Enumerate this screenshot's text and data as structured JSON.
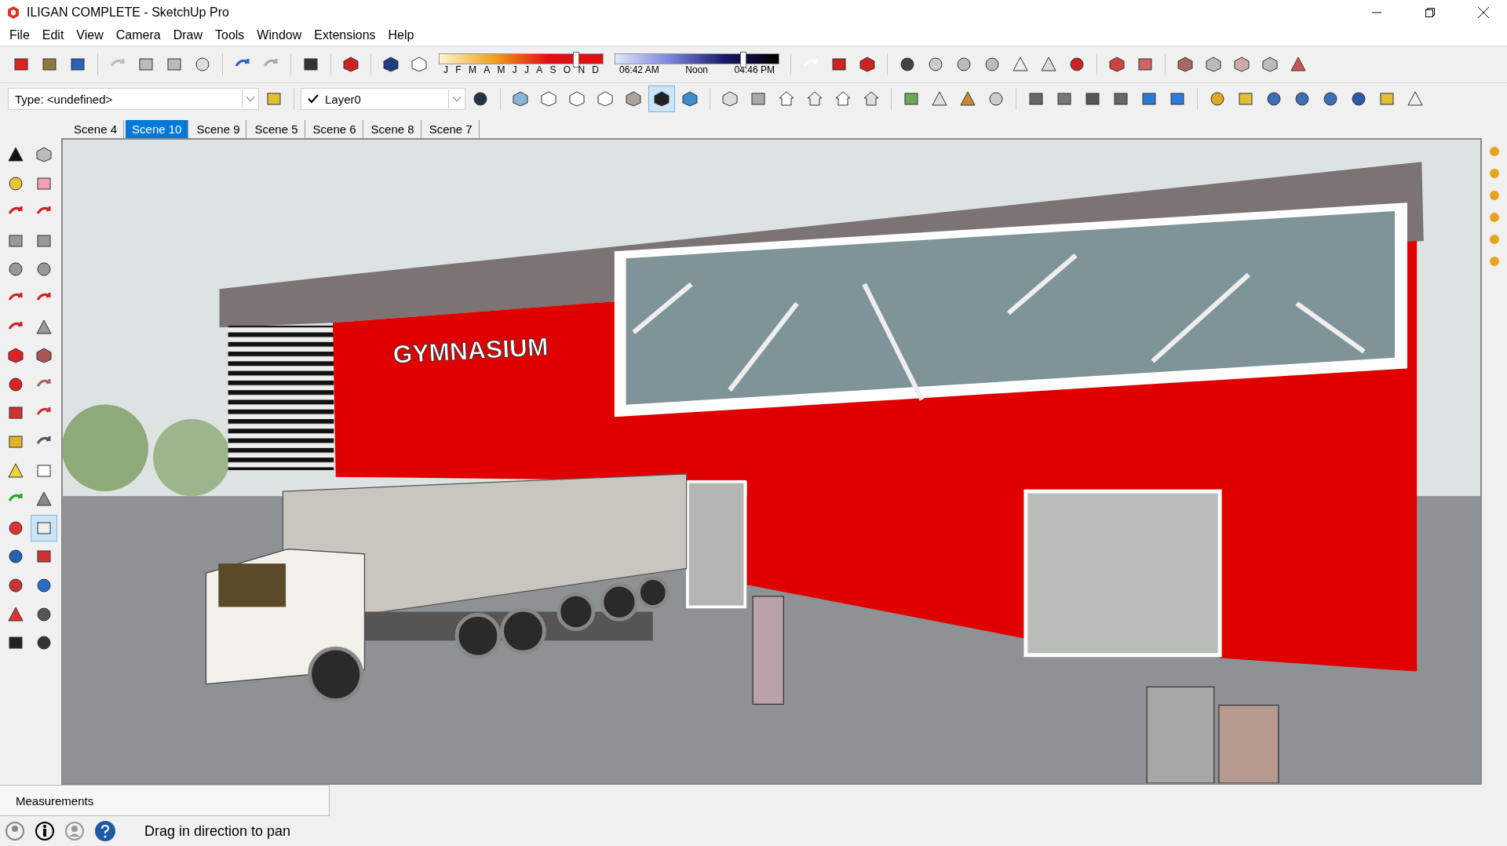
{
  "window": {
    "title": "ILIGAN COMPLETE - SketchUp Pro"
  },
  "menu": [
    "File",
    "Edit",
    "View",
    "Camera",
    "Draw",
    "Tools",
    "Window",
    "Extensions",
    "Help"
  ],
  "shadow_toolbar": {
    "months": [
      "J",
      "F",
      "M",
      "A",
      "M",
      "J",
      "J",
      "A",
      "S",
      "O",
      "N",
      "D"
    ],
    "date_slider": {
      "level": 0.83
    },
    "times": [
      "06:42 AM",
      "Noon",
      "04:46 PM"
    ],
    "time_slider": {
      "level": 0.78
    }
  },
  "entity_type": {
    "value": "Type: <undefined>"
  },
  "layer": {
    "value": "Layer0",
    "checked": true
  },
  "style_buttons": [
    {
      "selected": false
    },
    {
      "selected": false
    },
    {
      "selected": false
    },
    {
      "selected": false
    },
    {
      "selected": false
    },
    {
      "selected": true
    },
    {
      "selected": false
    }
  ],
  "scenes": [
    {
      "label": "Scene 4",
      "selected": false
    },
    {
      "label": "Scene 10",
      "selected": true
    },
    {
      "label": "Scene 9",
      "selected": false
    },
    {
      "label": "Scene 5",
      "selected": false
    },
    {
      "label": "Scene 6",
      "selected": false
    },
    {
      "label": "Scene 8",
      "selected": false
    },
    {
      "label": "Scene 7",
      "selected": false
    }
  ],
  "tool_palette": [
    {
      "selected": false
    },
    {
      "selected": false
    },
    {
      "selected": false
    },
    {
      "selected": false
    },
    {
      "selected": false
    },
    {
      "selected": false
    },
    {
      "selected": false
    },
    {
      "selected": false
    },
    {
      "selected": false
    },
    {
      "selected": false
    },
    {
      "selected": false
    },
    {
      "selected": false
    },
    {
      "selected": false
    },
    {
      "selected": false
    },
    {
      "selected": false
    },
    {
      "selected": false
    },
    {
      "selected": false
    },
    {
      "selected": false
    },
    {
      "selected": false
    },
    {
      "selected": false
    },
    {
      "selected": false
    },
    {
      "selected": false
    },
    {
      "selected": false
    },
    {
      "selected": false
    },
    {
      "selected": false
    },
    {
      "selected": false
    },
    {
      "selected": false
    },
    {
      "selected": true
    },
    {
      "selected": false
    },
    {
      "selected": false
    },
    {
      "selected": false
    },
    {
      "selected": false
    },
    {
      "selected": false
    },
    {
      "selected": false
    },
    {
      "selected": false
    },
    {
      "selected": false
    }
  ],
  "viewport": {
    "sign": "GYMNASIUM"
  },
  "measurements": {
    "label": "Measurements"
  },
  "status": {
    "hint": "Drag in direction to pan"
  }
}
